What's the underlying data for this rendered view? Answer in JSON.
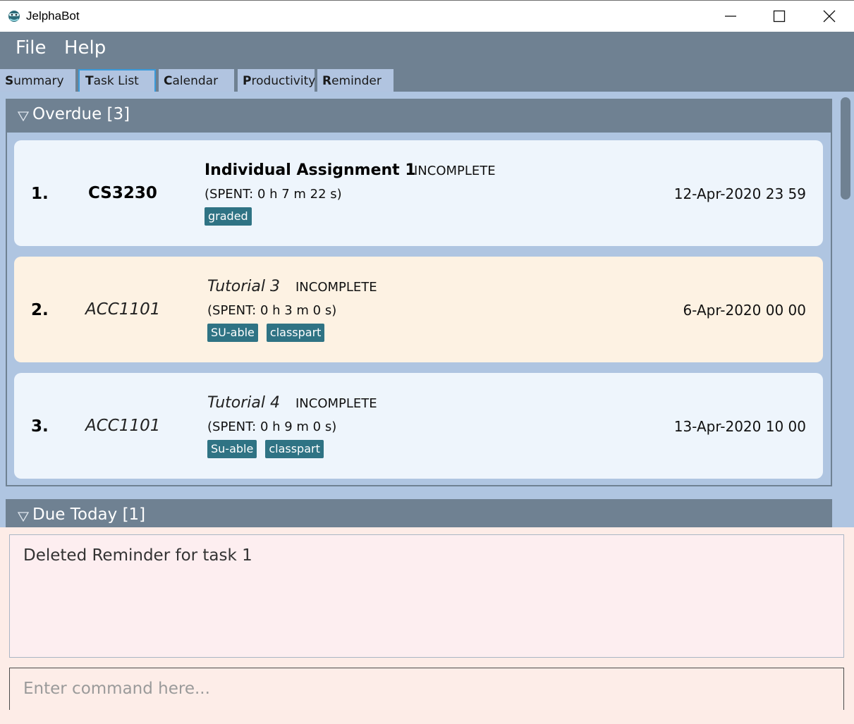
{
  "window": {
    "title": "JelphaBot",
    "icon": "jelphabot-logo-icon",
    "controls": [
      "minimize-icon",
      "maximize-icon",
      "close-icon"
    ]
  },
  "menu": {
    "file": "File",
    "help": "Help"
  },
  "tabs": [
    {
      "mnemonic": "S",
      "rest": "ummary"
    },
    {
      "mnemonic": "T",
      "rest": "ask List",
      "selected": true
    },
    {
      "mnemonic": "C",
      "rest": "alendar"
    },
    {
      "mnemonic": "P",
      "rest": "roductivity"
    },
    {
      "mnemonic": "R",
      "rest": "eminder"
    }
  ],
  "sections": {
    "overdue": {
      "title": "Overdue [3]",
      "tasks": [
        {
          "number": "1.",
          "module": "CS3230",
          "name": "Individual Assignment 1",
          "status": "INCOMPLETE",
          "spent": "(SPENT: 0 h 7 m 22 s)",
          "tags": [
            "graded"
          ],
          "date": "12-Apr-2020 23 59"
        },
        {
          "number": "2.",
          "module": "ACC1101",
          "name": "Tutorial 3",
          "status": "INCOMPLETE",
          "spent": "(SPENT: 0 h 3 m 0 s)",
          "tags": [
            "SU-able",
            "classpart"
          ],
          "date": "6-Apr-2020 00 00"
        },
        {
          "number": "3.",
          "module": "ACC1101",
          "name": "Tutorial 4",
          "status": "INCOMPLETE",
          "spent": "(SPENT: 0 h 9 m 0 s)",
          "tags": [
            "Su-able",
            "classpart"
          ],
          "date": "13-Apr-2020 10 00"
        }
      ]
    },
    "due_today": {
      "title": "Due Today [1]"
    }
  },
  "result": {
    "text": "Deleted Reminder for task 1"
  },
  "command": {
    "placeholder": "Enter command here...",
    "value": ""
  },
  "colors": {
    "header": "#6f8192",
    "list_background": "#afc5e1",
    "card_blue": "#eef5fc",
    "card_peach": "#fdf2e3",
    "tag": "#2f7384",
    "result_background": "#fdeef0"
  }
}
